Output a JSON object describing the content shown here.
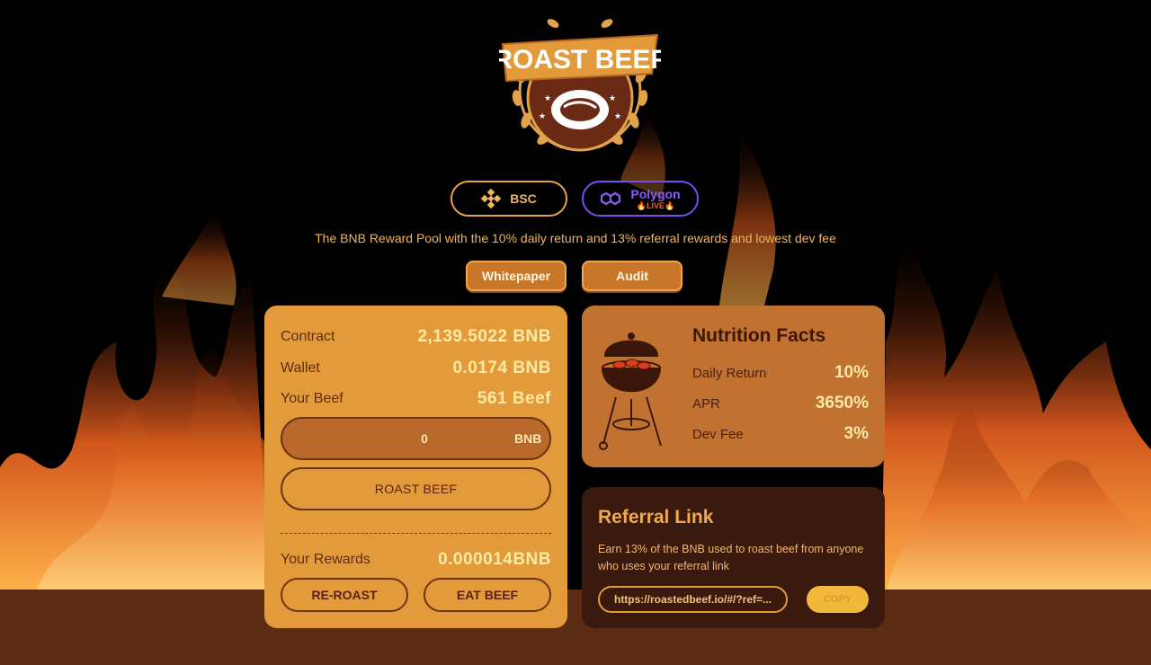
{
  "logo": {
    "text": "ROAST BEEF"
  },
  "networks": {
    "bsc": {
      "label": "BSC",
      "icon": "binance-icon"
    },
    "polygon": {
      "label": "Polygon",
      "badge": "🔥LIVE🔥",
      "icon": "polygon-icon"
    }
  },
  "tagline": "The BNB Reward Pool with the 10% daily return and 13% referral rewards and lowest dev fee",
  "links": {
    "whitepaper": "Whitepaper",
    "audit": "Audit"
  },
  "stats": {
    "contract_label": "Contract",
    "contract_value": "2,139.5022 BNB",
    "wallet_label": "Wallet",
    "wallet_value": "0.0174 BNB",
    "beef_label": "Your Beef",
    "beef_value": "561 Beef"
  },
  "amount": {
    "value": "0",
    "unit": "BNB"
  },
  "roast_button": "ROAST BEEF",
  "rewards": {
    "label": "Your Rewards",
    "value": "0.000014BNB"
  },
  "actions": {
    "reroast": "RE-ROAST",
    "eat": "EAT BEEF"
  },
  "nutrition": {
    "title": "Nutrition Facts",
    "daily_label": "Daily Return",
    "daily_value": "10%",
    "apr_label": "APR",
    "apr_value": "3650%",
    "fee_label": "Dev Fee",
    "fee_value": "3%"
  },
  "referral": {
    "title": "Referral Link",
    "description": "Earn 13% of the BNB used to roast beef from anyone who uses your referral link",
    "link": "https://roastedbeef.io/#/?ref=...",
    "copy": "COPY"
  },
  "colors": {
    "card": "#e39a3b",
    "nutrition_card": "#c27230",
    "referral_card": "#3a1a0e",
    "ground": "#5a2c14",
    "polygon_accent": "#7a4df0"
  }
}
